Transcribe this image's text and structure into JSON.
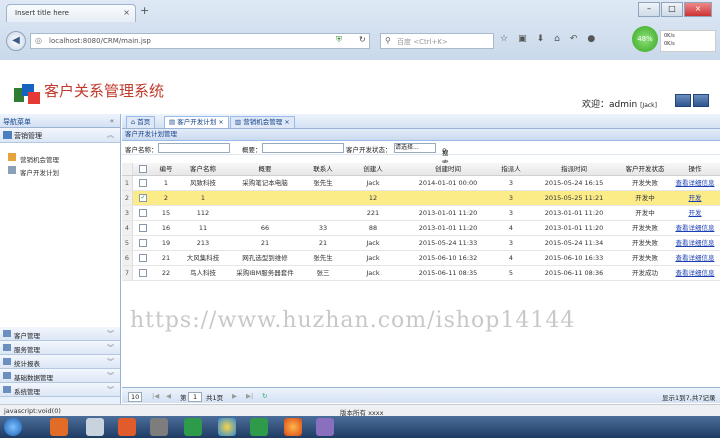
{
  "browser": {
    "tab_title": "Insert title here",
    "tab_close": "×",
    "new_tab": "+",
    "url": "localhost:8080/CRM/main.jsp",
    "search_placeholder": "百度 <Ctrl+K>",
    "speed_badge": "48%",
    "speed_up": "0K/s",
    "speed_down": "0K/s"
  },
  "app": {
    "title": "客户关系管理系统",
    "welcome_prefix": "欢迎：admin",
    "welcome_role": "[Jack]"
  },
  "sidebar": {
    "header": "导航菜单",
    "header_chevron": "«",
    "active_group": "营销管理",
    "items": [
      {
        "label": "营销机会管理"
      },
      {
        "label": "客户开发计划"
      }
    ],
    "bottom_groups": [
      {
        "label": "客户管理"
      },
      {
        "label": "服务管理"
      },
      {
        "label": "统计报表"
      },
      {
        "label": "基础数据管理"
      },
      {
        "label": "系统管理"
      }
    ]
  },
  "tabs": [
    {
      "label": "首页"
    },
    {
      "label": "客户开发计划 ×"
    },
    {
      "label": "营销机会管理 ×"
    }
  ],
  "panel": {
    "title": "客户开发计划管理"
  },
  "filters": {
    "customer_label": "客户名称：",
    "summary_label": "概要：",
    "status_label": "客户开发状态：",
    "status_value": "请选择...",
    "search_button": "搜索"
  },
  "grid": {
    "columns": [
      "",
      "",
      "编号",
      "客户名称",
      "概要",
      "联系人",
      "创建人",
      "创建时间",
      "指派人",
      "指派时间",
      "客户开发状态",
      "操作"
    ],
    "rows": [
      {
        "rn": "1",
        "id": "1",
        "customer": "风致科技",
        "summary": "采购笔记本电脑",
        "contact": "张先生",
        "creator": "Jack",
        "created": "2014-01-01 00:00",
        "assignee": "3",
        "assigned": "2015-05-24 16:15",
        "status": "开发失败",
        "action": "查看详细信息"
      },
      {
        "rn": "2",
        "id": "2",
        "customer": "1",
        "summary": "",
        "contact": "",
        "creator": "12",
        "created": "",
        "assignee": "3",
        "assigned": "2015-05-25 11:21",
        "status": "开发中",
        "action": "开发"
      },
      {
        "rn": "3",
        "id": "15",
        "customer": "112",
        "summary": "",
        "contact": "",
        "creator": "221",
        "created": "2013-01-01 11:20",
        "assignee": "3",
        "assigned": "2013-01-01 11:20",
        "status": "开发中",
        "action": "开发"
      },
      {
        "rn": "4",
        "id": "16",
        "customer": "11",
        "summary": "66",
        "contact": "33",
        "creator": "88",
        "created": "2013-01-01 11:20",
        "assignee": "4",
        "assigned": "2013-01-01 11:20",
        "status": "开发失败",
        "action": "查看详细信息"
      },
      {
        "rn": "5",
        "id": "19",
        "customer": "213",
        "summary": "21",
        "contact": "21",
        "creator": "Jack",
        "created": "2015-05-24 11:33",
        "assignee": "3",
        "assigned": "2015-05-24 11:34",
        "status": "开发失败",
        "action": "查看详细信息"
      },
      {
        "rn": "6",
        "id": "21",
        "customer": "大风集科技",
        "summary": "网孔选型到维修",
        "contact": "张先生",
        "creator": "Jack",
        "created": "2015-06-10 16:32",
        "assignee": "4",
        "assigned": "2015-06-10 16:33",
        "status": "开发失败",
        "action": "查看详细信息"
      },
      {
        "rn": "7",
        "id": "22",
        "customer": "鸟人科技",
        "summary": "采购IBM服务器套件",
        "contact": "张三",
        "creator": "Jack",
        "created": "2015-06-11 08:35",
        "assignee": "5",
        "assigned": "2015-06-11 08:36",
        "status": "开发成功",
        "action": "查看详细信息"
      }
    ]
  },
  "pager": {
    "page_size": "10",
    "page_label": "第",
    "page_value": "1",
    "of_pages": "共1页",
    "summary": "显示1到7,共7记录"
  },
  "watermark": "https://www.huzhan.com/ishop14144",
  "status_bar": {
    "left": "javascript:void(0)",
    "center": "版本所有 xxxx"
  },
  "colors": {
    "title_red": "#c0392b",
    "selected_row": "#fbec88",
    "link_blue": "#1a3fb4"
  }
}
